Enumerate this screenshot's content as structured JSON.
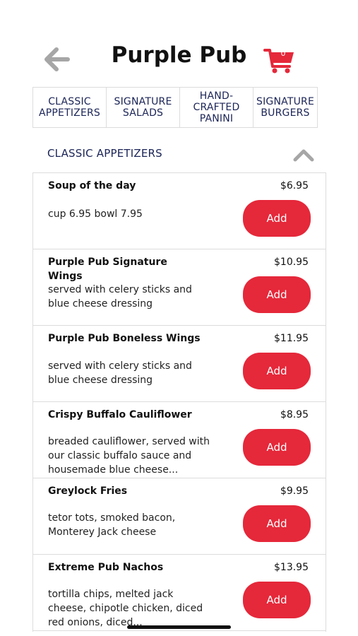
{
  "header": {
    "title": "Purple Pub",
    "cart_count": "0"
  },
  "tabs": [
    {
      "label": "CLASSIC\nAPPETIZERS"
    },
    {
      "label": "SIGNATURE\nSALADS"
    },
    {
      "label": "HAND-\nCRAFTED\nPANINI"
    },
    {
      "label": "SIGNATURE\nBURGERS"
    }
  ],
  "section": {
    "title": "CLASSIC APPETIZERS"
  },
  "items": [
    {
      "name": "Soup of the day",
      "price": "$6.95",
      "description": "cup 6.95 bowl 7.95",
      "add_label": "Add"
    },
    {
      "name": "Purple Pub Signature Wings",
      "price": "$10.95",
      "description": "served with celery sticks and blue cheese dressing",
      "add_label": "Add"
    },
    {
      "name": "Purple Pub Boneless Wings",
      "price": "$11.95",
      "description": "served with celery sticks and blue cheese dressing",
      "add_label": "Add"
    },
    {
      "name": "Crispy Buffalo Cauliflower",
      "price": "$8.95",
      "description": "breaded cauliflower, served with our classic buffalo sauce and housemade blue cheese...",
      "add_label": "Add"
    },
    {
      "name": "Greylock Fries",
      "price": "$9.95",
      "description": "tetor tots, smoked bacon, Monterey Jack cheese",
      "add_label": "Add"
    },
    {
      "name": "Extreme Pub Nachos",
      "price": "$13.95",
      "description": "tortilla chips, melted jack cheese, chipotle chicken, diced red onions, diced...",
      "add_label": "Add"
    }
  ],
  "colors": {
    "accent": "#e5283a",
    "nav_text": "#1b2457",
    "icon_gray": "#a6a6a6"
  },
  "icons": {
    "back": "arrow-left-icon",
    "cart": "cart-icon",
    "collapse": "chevron-up-icon"
  }
}
